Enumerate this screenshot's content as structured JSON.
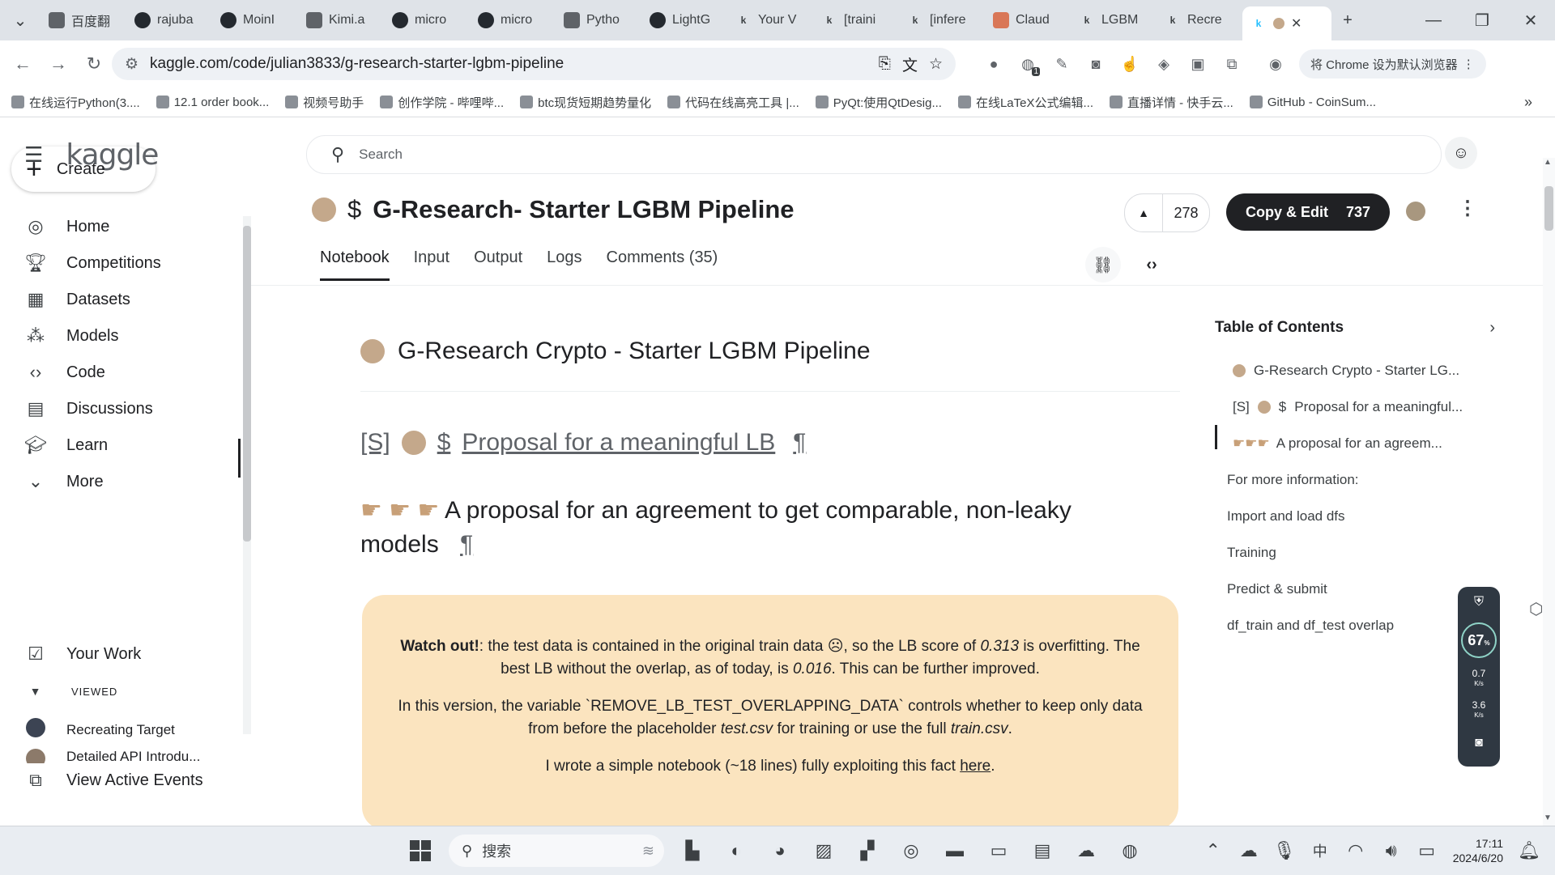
{
  "browser": {
    "tabs": [
      {
        "label": "百度翻",
        "icon": "baidu-icon"
      },
      {
        "label": "rajuba",
        "icon": "github-icon"
      },
      {
        "label": "MoinI",
        "icon": "github-icon"
      },
      {
        "label": "Kimi.a",
        "icon": "kimi-icon"
      },
      {
        "label": "micro",
        "icon": "github-icon"
      },
      {
        "label": "micro",
        "icon": "github-icon"
      },
      {
        "label": "Pytho",
        "icon": "python-icon"
      },
      {
        "label": "LightG",
        "icon": "github-icon"
      },
      {
        "label": "Your V",
        "icon": "kaggle-icon"
      },
      {
        "label": "[traini",
        "icon": "kaggle-icon"
      },
      {
        "label": "[infere",
        "icon": "kaggle-icon"
      },
      {
        "label": "Claud",
        "icon": "claude-icon"
      },
      {
        "label": "LGBM",
        "icon": "kaggle-icon"
      },
      {
        "label": "Recre",
        "icon": "kaggle-icon"
      }
    ],
    "active_tab_icon": "kaggle-icon",
    "url": "kaggle.com/code/julian3833/g-research-starter-lgbm-pipeline",
    "default_browser_label": "将 Chrome 设为默认浏览器",
    "extension_badge": "1",
    "bookmarks": [
      "在线运行Python(3....",
      "12.1 order book...",
      "视频号助手",
      "创作学院 - 哔哩哔...",
      "btc现货短期趋势量化",
      "代码在线高亮工具 |...",
      "PyQt:使用QtDesig...",
      "在线LaTeX公式编辑...",
      "直播详情 - 快手云...",
      "GitHub - CoinSum..."
    ]
  },
  "kaggle": {
    "logo": "kaggle",
    "create_label": "Create",
    "nav": [
      {
        "label": "Home",
        "icon": "compass-icon"
      },
      {
        "label": "Competitions",
        "icon": "trophy-icon"
      },
      {
        "label": "Datasets",
        "icon": "table-icon"
      },
      {
        "label": "Models",
        "icon": "models-icon"
      },
      {
        "label": "Code",
        "icon": "code-icon"
      },
      {
        "label": "Discussions",
        "icon": "discussion-icon"
      },
      {
        "label": "Learn",
        "icon": "learn-icon"
      },
      {
        "label": "More",
        "icon": "chevron-down-icon"
      }
    ],
    "your_work": "Your Work",
    "viewed_label": "VIEWED",
    "viewed_items": [
      "Recreating Target",
      "Detailed API Introdu..."
    ],
    "view_active_events": "View Active Events",
    "search_placeholder": "Search",
    "notebook_title_prefix": "$",
    "notebook_title": "G-Research- Starter LGBM Pipeline",
    "upvotes": "278",
    "copy_edit_label": "Copy & Edit",
    "copy_edit_count": "737",
    "tabs": [
      "Notebook",
      "Input",
      "Output",
      "Logs",
      "Comments (35)"
    ],
    "h1": "G-Research Crypto - Starter LGBM Pipeline",
    "h2_prefix": "[S]",
    "h2_dollar": "$",
    "h2": "Proposal for a meaningful LB",
    "pilcrow": "¶",
    "h3": "A proposal for an agreement to get comparable, non-leaky",
    "h3_line2": "models",
    "callout": {
      "p1_bold": "Watch out!",
      "p1_a": ": the test data is contained in the original train data",
      "p1_b": ", so the LB score of",
      "p1_score": "0.313",
      "p1_c": "is overfitting. The best LB without the overlap, as of today, is",
      "p1_best": "0.016",
      "p1_d": ". This can be further improved.",
      "p2_a": "In this version, the variable `REMOVE_LB_TEST_OVERLAPPING_DATA` controls whether to keep only data from before the placeholder",
      "p2_file1": "test.csv",
      "p2_b": "for training or use the full",
      "p2_file2": "train.csv",
      "p2_c": ".",
      "p3_a": "I wrote a simple notebook (~18 lines) fully exploiting this fact",
      "p3_link": "here",
      "p3_b": "."
    },
    "toc_title": "Table of Contents",
    "toc": [
      "G-Research Crypto - Starter LG...",
      "Proposal for a meaningful...",
      "A proposal for an agreem...",
      "For more information:",
      "Import and load dfs",
      "Training",
      "Predict & submit",
      "df_train and df_test overlap"
    ],
    "toc_prefix_1": "[S]",
    "toc_prefix_2": "$"
  },
  "net_widget": {
    "percent": "67",
    "percent_unit": "%",
    "up": "0.7",
    "up_unit": "K/s",
    "down": "3.6",
    "down_unit": "K/s"
  },
  "taskbar": {
    "search_label": "搜索",
    "ime": "中",
    "time": "17:11",
    "date": "2024/6/20"
  }
}
